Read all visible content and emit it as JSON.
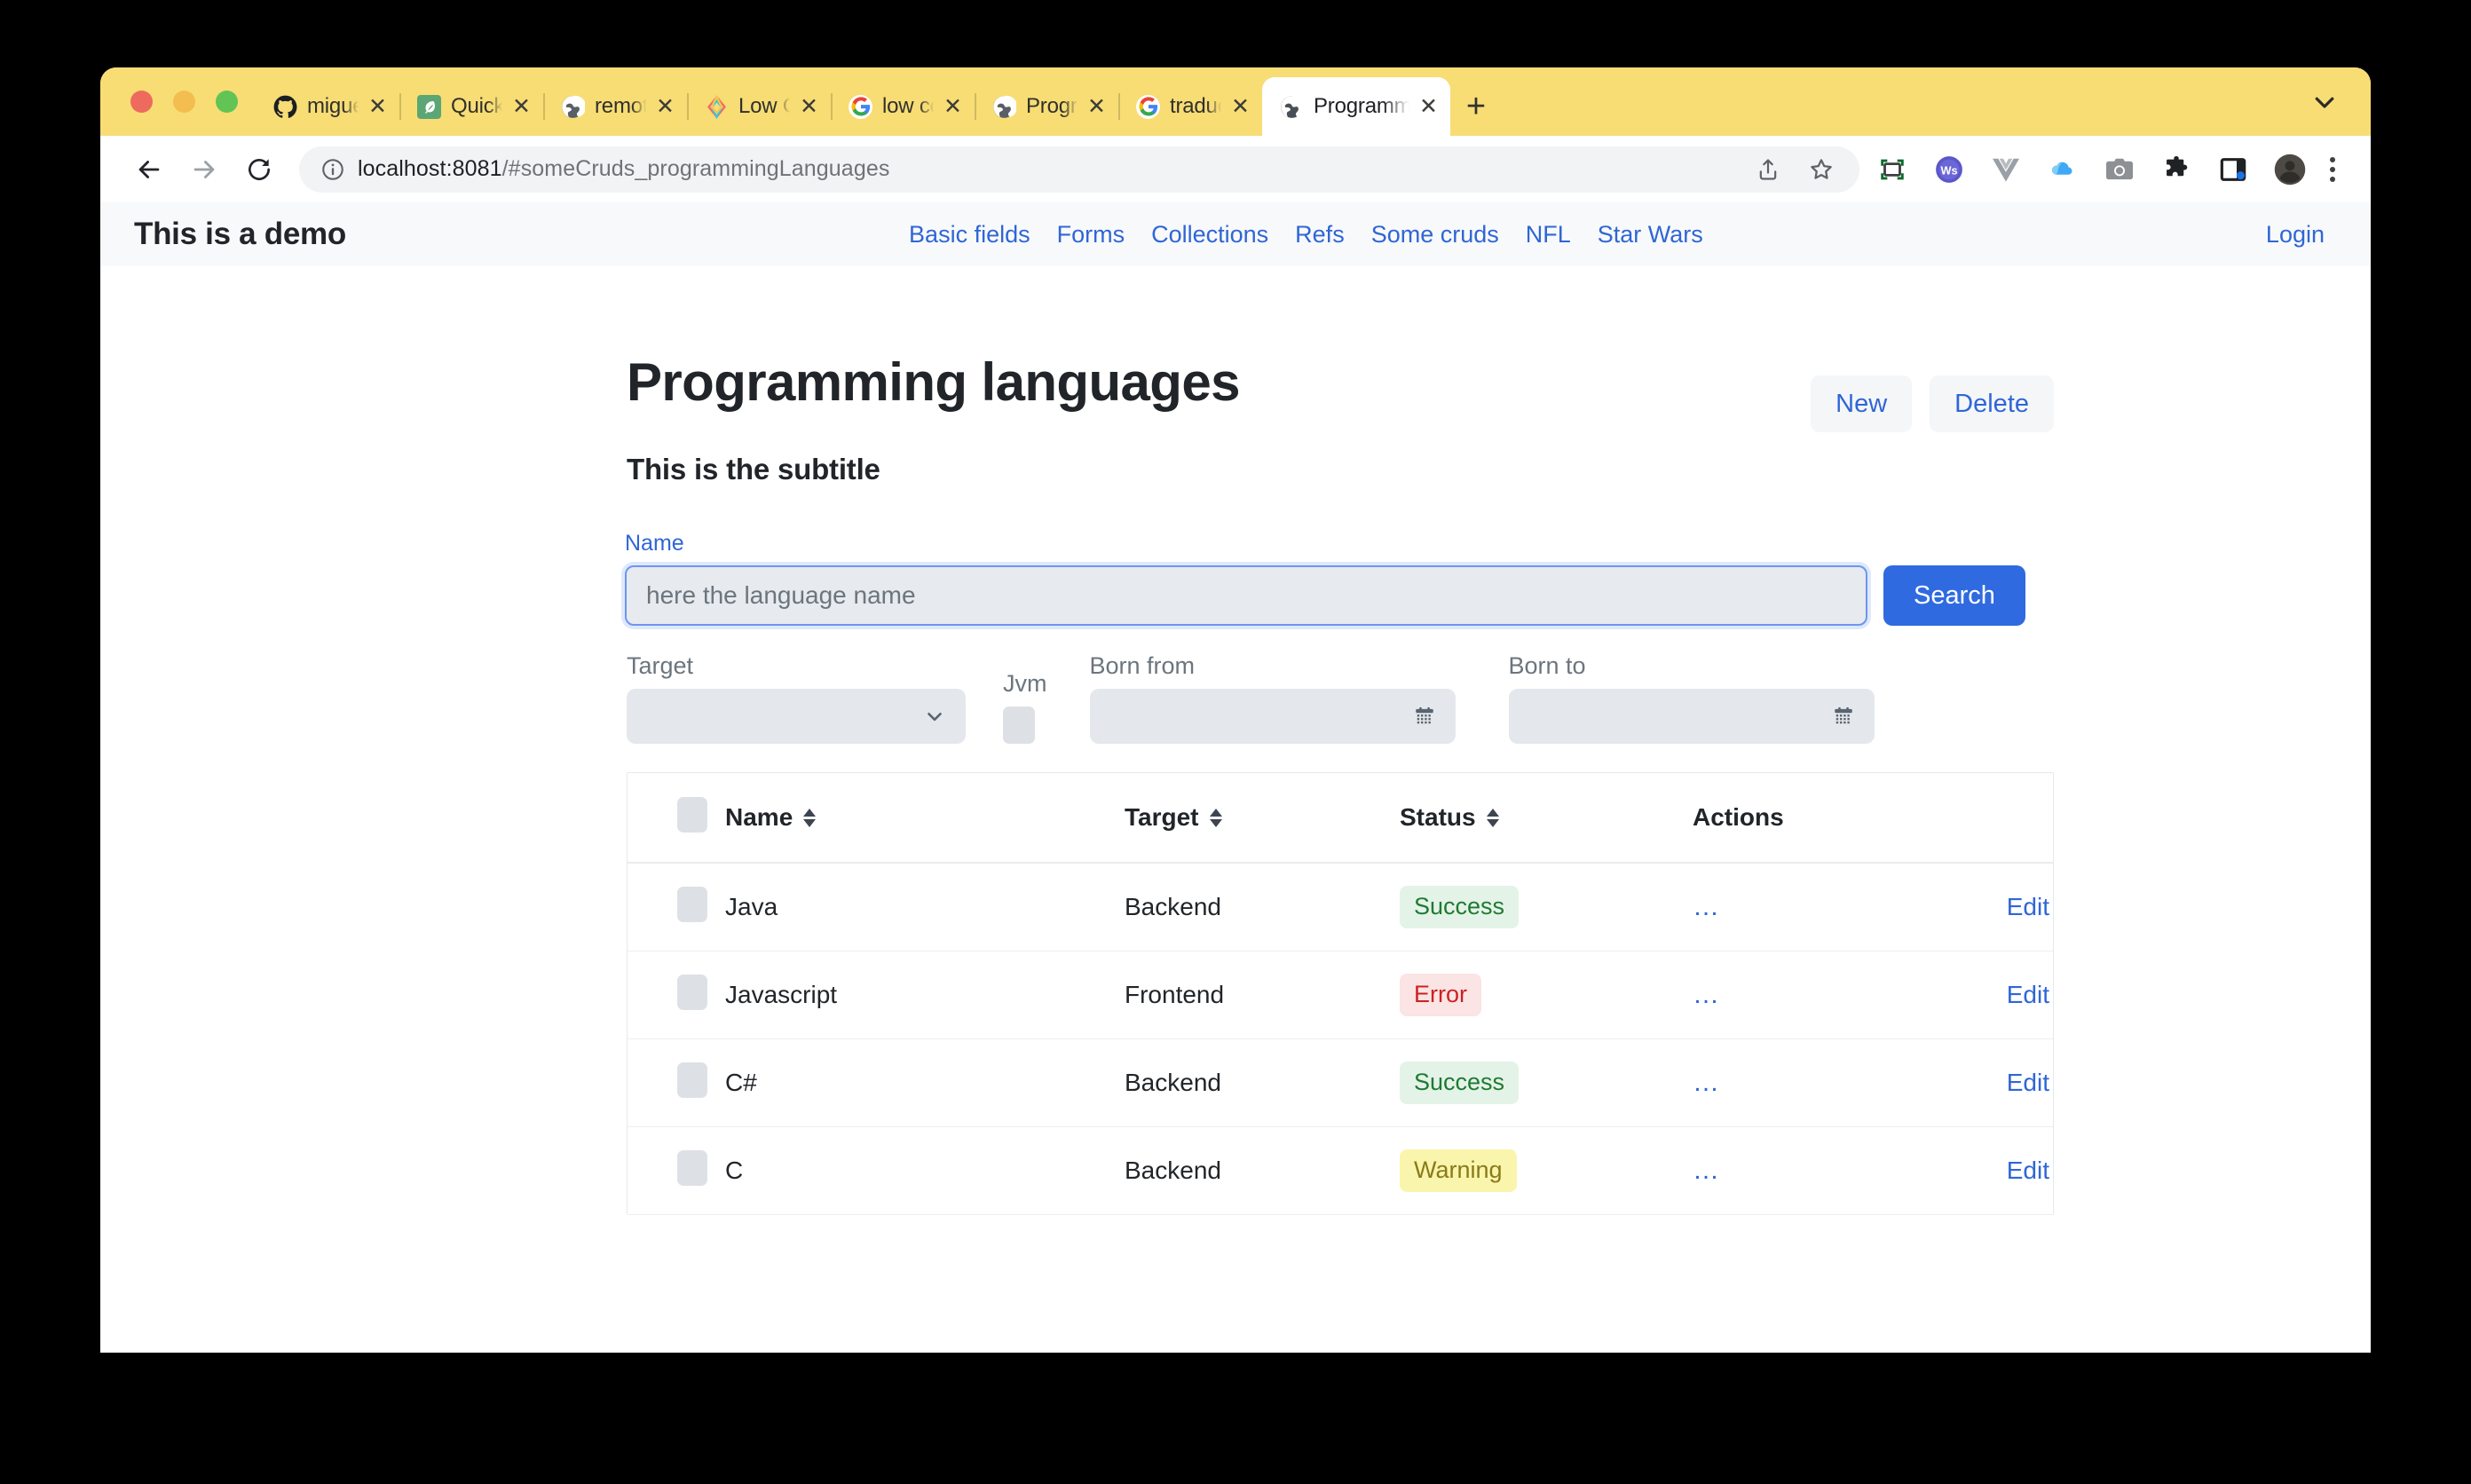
{
  "browser": {
    "tabs": [
      {
        "title": "miguelperez",
        "favicon": "github-icon",
        "active": false
      },
      {
        "title": "Quick Guide",
        "favicon": "leaf-icon",
        "active": false
      },
      {
        "title": "remote.mate",
        "favicon": "globe-icon",
        "active": false
      },
      {
        "title": "Low Code Pl",
        "favicon": "diamond-icon",
        "active": false
      },
      {
        "title": "low code ap",
        "favicon": "google-icon",
        "active": false
      },
      {
        "title": "Programmin",
        "favicon": "globe-icon",
        "active": false
      },
      {
        "title": "traductor - E",
        "favicon": "google-icon",
        "active": false
      },
      {
        "title": "Programmin",
        "favicon": "globe-icon",
        "active": true
      }
    ],
    "close_label": "✕",
    "new_tab_label": "+",
    "url_host": "localhost:8081",
    "url_path": "/#someCruds_programmingLanguages",
    "toolbar_icons": [
      "back-icon",
      "forward-icon",
      "reload-icon",
      "info-icon",
      "share-icon",
      "bookmark-star-icon",
      "screenshot-capture-icon",
      "ws-extension-icon",
      "vue-devtools-icon",
      "cloud-icon",
      "camera-icon",
      "puzzle-extensions-icon",
      "side-panel-icon",
      "profile-avatar-icon",
      "more-menu-icon"
    ]
  },
  "app": {
    "brand": "This is a demo",
    "nav_links": [
      "Basic fields",
      "Forms",
      "Collections",
      "Refs",
      "Some cruds",
      "NFL",
      "Star Wars"
    ],
    "login": "Login"
  },
  "main": {
    "title": "Programming languages",
    "subtitle": "This is the subtitle",
    "buttons": {
      "new": "New",
      "delete": "Delete"
    },
    "search": {
      "label": "Name",
      "placeholder": "here the language name",
      "value": "",
      "button": "Search"
    },
    "filters": {
      "target": {
        "label": "Target",
        "value": ""
      },
      "jvm": {
        "label": "Jvm",
        "checked": false
      },
      "born_from": {
        "label": "Born from",
        "value": ""
      },
      "born_to": {
        "label": "Born to",
        "value": ""
      }
    },
    "table": {
      "columns": [
        {
          "key": "check",
          "label": "",
          "sortable": false
        },
        {
          "key": "name",
          "label": "Name",
          "sortable": true
        },
        {
          "key": "target",
          "label": "Target",
          "sortable": true
        },
        {
          "key": "status",
          "label": "Status",
          "sortable": true
        },
        {
          "key": "actions",
          "label": "Actions",
          "sortable": false
        },
        {
          "key": "edit",
          "label": "",
          "sortable": false
        }
      ],
      "rows": [
        {
          "name": "Java",
          "target": "Backend",
          "status": "Success",
          "status_kind": "success",
          "actions": "…",
          "edit": "Edit"
        },
        {
          "name": "Javascript",
          "target": "Frontend",
          "status": "Error",
          "status_kind": "error",
          "actions": "…",
          "edit": "Edit"
        },
        {
          "name": "C#",
          "target": "Backend",
          "status": "Success",
          "status_kind": "success",
          "actions": "…",
          "edit": "Edit"
        },
        {
          "name": "C",
          "target": "Backend",
          "status": "Warning",
          "status_kind": "warning",
          "actions": "…",
          "edit": "Edit"
        }
      ]
    }
  },
  "colors": {
    "tabbar_yellow": "#f7dd74",
    "accent_blue": "#2f66d6",
    "search_button": "#2f6ae0",
    "success_bg": "#e4f3e7",
    "success_fg": "#1f7a34",
    "error_bg": "#fbe4e4",
    "error_fg": "#cc2222",
    "warning_bg": "#faf5ad",
    "warning_fg": "#8a7a19",
    "navbar_bg": "#f8f9fa",
    "field_bg": "#e4e8ec"
  }
}
